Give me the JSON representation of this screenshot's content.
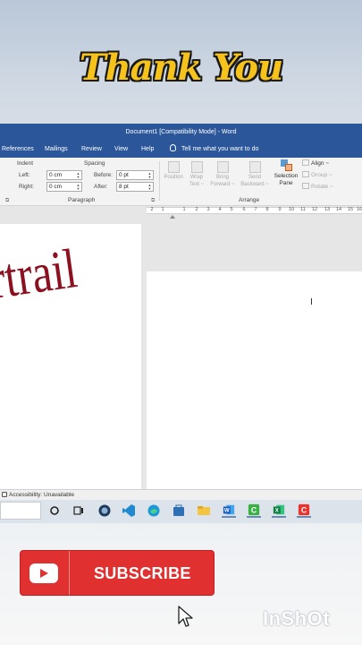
{
  "banner": {
    "text": "Thank You"
  },
  "word": {
    "title": "Document1 [Compatibility Mode] - Word",
    "tabs": [
      "References",
      "Mailings",
      "Review",
      "View",
      "Help"
    ],
    "tell_me": "Tell me what you want to do",
    "paragraph": {
      "indent_label": "Indent",
      "left_label": "Left:",
      "left_value": "0 cm",
      "right_label": "Right:",
      "right_value": "0 cm",
      "spacing_label": "Spacing",
      "before_label": "Before:",
      "before_value": "0 pt",
      "after_label": "After:",
      "after_value": "8 pt",
      "group_name": "Paragraph"
    },
    "arrange": {
      "position": [
        "Position",
        "~"
      ],
      "wrap_text": [
        "Wrap",
        "Text ~"
      ],
      "bring_forward": [
        "Bring",
        "Forward ~"
      ],
      "send_backward": [
        "Send",
        "Backward ~"
      ],
      "selection_pane": [
        "Selection",
        "Pane"
      ],
      "align": "Align ~",
      "group": "Group ~",
      "rotate": "Rotate ~",
      "group_name": "Arrange"
    },
    "ruler_ticks": [
      "2",
      "1",
      "1",
      "2",
      "3",
      "4",
      "5",
      "6",
      "7",
      "8",
      "9",
      "10",
      "11",
      "12",
      "13",
      "14",
      "15",
      "16"
    ],
    "wordart_text": "rtrail",
    "status": "Accessibility: Unavailable"
  },
  "subscribe": {
    "label": "SUBSCRIBE"
  },
  "watermark": "InShOt"
}
